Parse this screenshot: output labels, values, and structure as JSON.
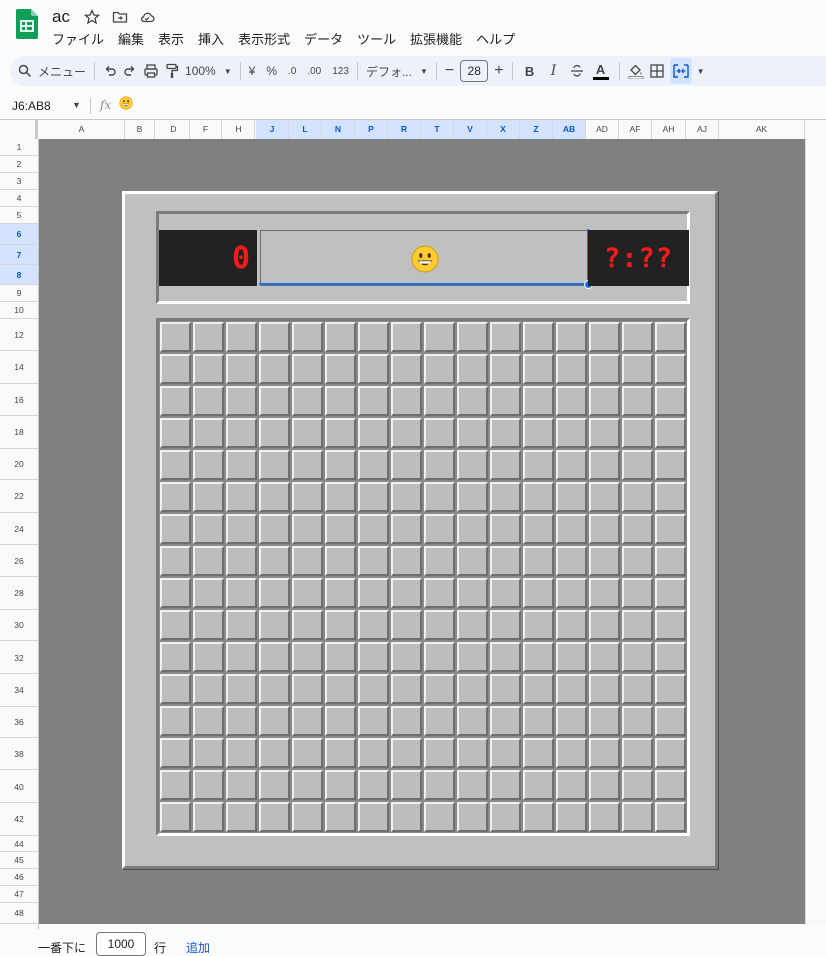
{
  "app": {
    "doc_title": "ac"
  },
  "menu": [
    "ファイル",
    "編集",
    "表示",
    "挿入",
    "表示形式",
    "データ",
    "ツール",
    "拡張機能",
    "ヘルプ"
  ],
  "toolbar": {
    "menu_search": "メニュー",
    "zoom": "100%",
    "currency": "¥",
    "percent": "%",
    "decrease_decimal": ".0",
    "increase_decimal": ".00",
    "number_format": "123",
    "font": "デフォ...",
    "font_size": "28",
    "bold": "B",
    "italic": "I",
    "text_color_letter": "A"
  },
  "formula_bar": {
    "name_box": "J6:AB8",
    "fx": "fx",
    "content_icon": "grinning-face-emoji"
  },
  "columns": [
    {
      "label": "A",
      "selected": false
    },
    {
      "label": "B",
      "selected": false
    },
    {
      "label": "D",
      "selected": false
    },
    {
      "label": "F",
      "selected": false
    },
    {
      "label": "H",
      "selected": false
    },
    {
      "label": "J",
      "selected": true
    },
    {
      "label": "L",
      "selected": true
    },
    {
      "label": "N",
      "selected": true
    },
    {
      "label": "P",
      "selected": true
    },
    {
      "label": "R",
      "selected": true
    },
    {
      "label": "T",
      "selected": true
    },
    {
      "label": "V",
      "selected": true
    },
    {
      "label": "X",
      "selected": true
    },
    {
      "label": "Z",
      "selected": true
    },
    {
      "label": "AB",
      "selected": true
    },
    {
      "label": "AD",
      "selected": false
    },
    {
      "label": "AF",
      "selected": false
    },
    {
      "label": "AH",
      "selected": false
    },
    {
      "label": "AJ",
      "selected": false
    },
    {
      "label": "AK",
      "selected": false
    }
  ],
  "rows": [
    {
      "label": "1",
      "selected": false
    },
    {
      "label": "2",
      "selected": false
    },
    {
      "label": "3",
      "selected": false
    },
    {
      "label": "4",
      "selected": false
    },
    {
      "label": "5",
      "selected": false
    },
    {
      "label": "6",
      "selected": true
    },
    {
      "label": "7",
      "selected": true
    },
    {
      "label": "8",
      "selected": true
    },
    {
      "label": "9",
      "selected": false
    },
    {
      "label": "10",
      "selected": false
    },
    {
      "label": "12",
      "selected": false
    },
    {
      "label": "14",
      "selected": false
    },
    {
      "label": "16",
      "selected": false
    },
    {
      "label": "18",
      "selected": false
    },
    {
      "label": "20",
      "selected": false
    },
    {
      "label": "22",
      "selected": false
    },
    {
      "label": "24",
      "selected": false
    },
    {
      "label": "26",
      "selected": false
    },
    {
      "label": "28",
      "selected": false
    },
    {
      "label": "30",
      "selected": false
    },
    {
      "label": "32",
      "selected": false
    },
    {
      "label": "34",
      "selected": false
    },
    {
      "label": "36",
      "selected": false
    },
    {
      "label": "38",
      "selected": false
    },
    {
      "label": "40",
      "selected": false
    },
    {
      "label": "42",
      "selected": false
    },
    {
      "label": "44",
      "selected": false
    },
    {
      "label": "45",
      "selected": false
    },
    {
      "label": "46",
      "selected": false
    },
    {
      "label": "47",
      "selected": false
    },
    {
      "label": "48",
      "selected": false
    }
  ],
  "game": {
    "mine_counter": "0",
    "timer": "?:??",
    "face": "grinning-face-emoji",
    "grid_columns": 16,
    "grid_rows": 16
  },
  "bottom": {
    "prefix": "一番下に",
    "rows_value": "1000",
    "suffix": "行",
    "add_label": "追加"
  },
  "colors": {
    "sheet_background": "#808080",
    "board_gray": "#c0c0c0",
    "lcd_background": "#222222",
    "lcd_digits": "#ff1a1a",
    "selection_blue": "#1a73e8",
    "sheets_green": "#0f9d58"
  }
}
